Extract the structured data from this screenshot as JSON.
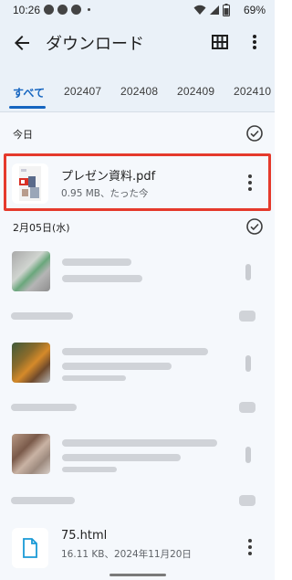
{
  "status_bar": {
    "time": "10:26",
    "battery": "69%"
  },
  "app_bar": {
    "title": "ダウンロード"
  },
  "tabs": [
    {
      "label": "すべて",
      "active": true
    },
    {
      "label": "202407",
      "active": false
    },
    {
      "label": "202408",
      "active": false
    },
    {
      "label": "202409",
      "active": false
    },
    {
      "label": "202410",
      "active": false
    }
  ],
  "sections": {
    "today": {
      "label": "今日"
    },
    "feb": {
      "label": "2月05日(水)"
    }
  },
  "files": {
    "pdf": {
      "name": "プレゼン資料.pdf",
      "meta": "0.95 MB、たった今"
    },
    "html": {
      "name": "75.html",
      "meta": "16.11 KB、2024年11月20日"
    }
  },
  "colors": {
    "accent": "#1565c0",
    "highlight": "#e53a2c",
    "header_bg": "#eaf1f8",
    "content_bg": "#f5f8fc"
  }
}
